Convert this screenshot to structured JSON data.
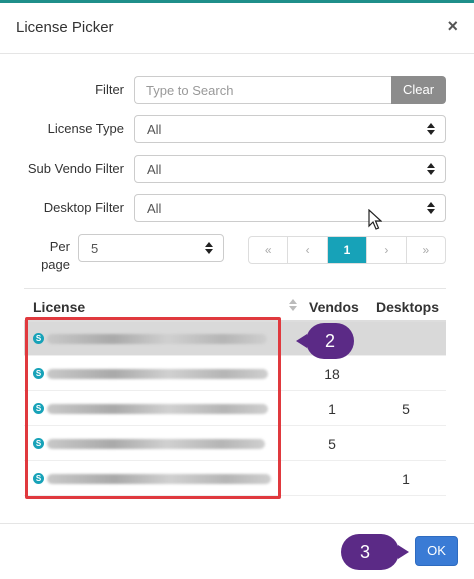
{
  "dialog": {
    "title": "License Picker",
    "close_glyph": "×"
  },
  "filters": {
    "filter_label": "Filter",
    "filter_placeholder": "Type to Search",
    "clear_label": "Clear",
    "license_type_label": "License Type",
    "license_type_value": "All",
    "sub_vendo_label": "Sub Vendo Filter",
    "sub_vendo_value": "All",
    "desktop_label": "Desktop Filter",
    "desktop_value": "All",
    "per_page_label": "Per page",
    "per_page_value": "5"
  },
  "pagination": {
    "first": "«",
    "prev": "‹",
    "current": "1",
    "next": "›",
    "last": "»"
  },
  "table": {
    "columns": {
      "license": "License",
      "vendos": "Vendos",
      "desktops": "Desktops"
    },
    "rows": [
      {
        "badge": "S",
        "vendos": "",
        "desktops": "",
        "selected": true
      },
      {
        "badge": "S",
        "vendos": "18",
        "desktops": ""
      },
      {
        "badge": "S",
        "vendos": "1",
        "desktops": "5"
      },
      {
        "badge": "S",
        "vendos": "5",
        "desktops": ""
      },
      {
        "badge": "S",
        "vendos": "",
        "desktops": "1"
      }
    ]
  },
  "callouts": {
    "step2": "2",
    "step3": "3"
  },
  "footer": {
    "ok_label": "OK"
  },
  "colors": {
    "accent": "#17a2b8",
    "callout": "#5b2a86",
    "highlight": "#e0393e",
    "primary_button": "#3a7bd5"
  },
  "icons": [
    "close-icon",
    "sort-icon",
    "select-arrows-icon",
    "license-s-badge-icon"
  ]
}
